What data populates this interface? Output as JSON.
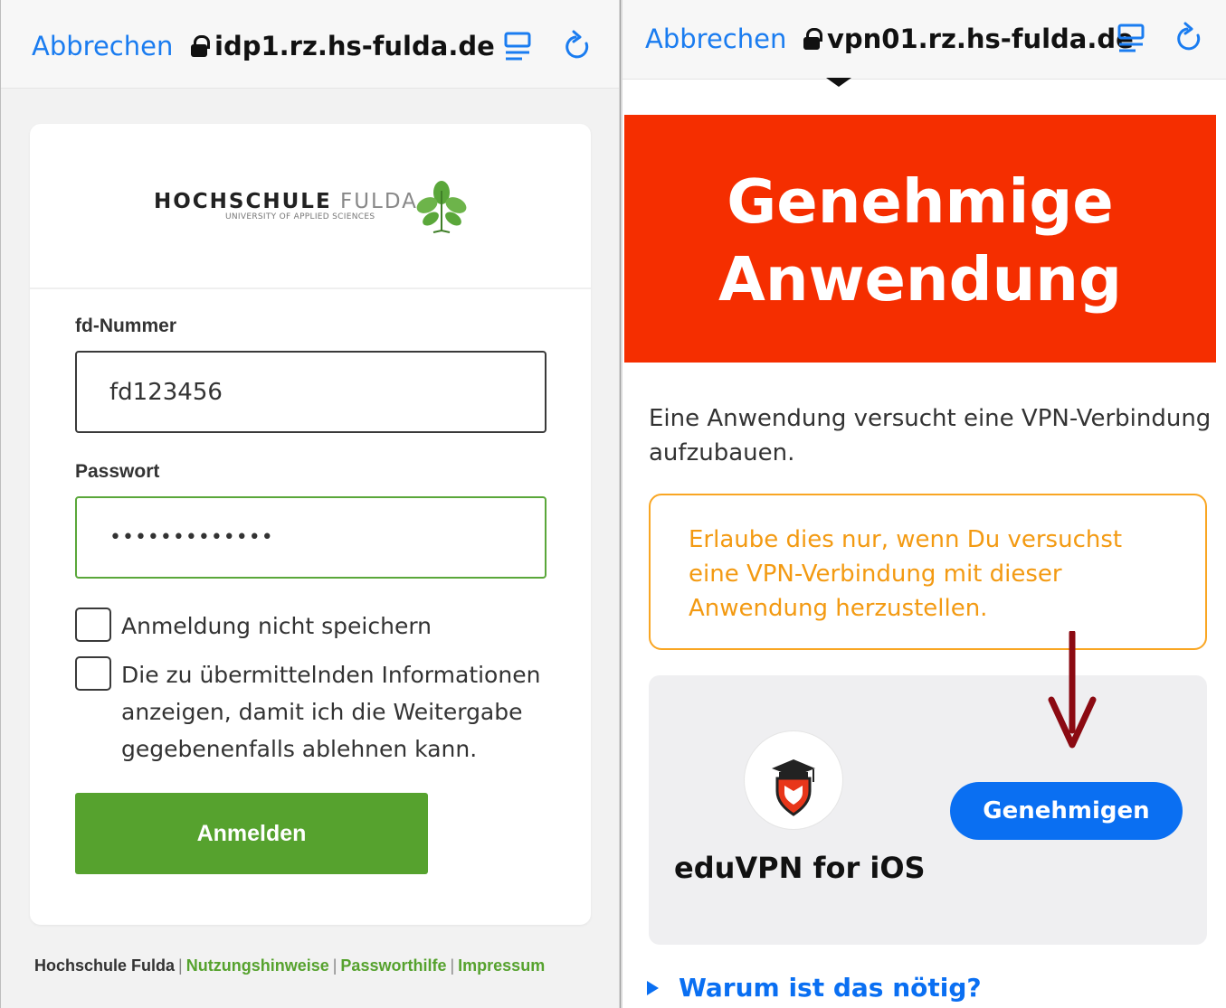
{
  "left_panel": {
    "topbar": {
      "cancel_label": "Abbrechen",
      "url": "idp1.rz.hs-fulda.de"
    },
    "logo": {
      "name_bold": "HOCHSCHULE",
      "name_light": "FULDA",
      "subtitle": "UNIVERSITY OF APPLIED SCIENCES"
    },
    "form": {
      "username_label": "fd-Nummer",
      "username_value": "fd123456",
      "password_label": "Passwort",
      "password_value": "•••••••••••••",
      "checkbox1_label": "Anmeldung nicht speichern",
      "checkbox2_lines": [
        "Die zu übermittelnden Informationen",
        "anzeigen, damit ich die Weitergabe",
        "gegebenenfalls ablehnen kann."
      ],
      "checkbox1_checked": false,
      "checkbox2_checked": false,
      "submit_label": "Anmelden"
    },
    "footer": {
      "org": "Hochschule Fulda",
      "sep": "|",
      "link1": "Nutzungshinweise",
      "link2": "Passworthilfe",
      "link3": "Impressum"
    }
  },
  "right_panel": {
    "topbar": {
      "cancel_label": "Abbrechen",
      "url": "vpn01.rz.hs-fulda.de"
    },
    "hero": {
      "line1": "Genehmige",
      "line2": "Anwendung"
    },
    "intro_lines": [
      "Eine Anwendung versucht eine VPN-Verbindung",
      "aufzubauen."
    ],
    "warning_lines": [
      "Erlaube dies nur, wenn Du versuchst",
      "eine VPN-Verbindung mit dieser",
      "Anwendung herzustellen."
    ],
    "app": {
      "name": "eduVPN for iOS",
      "approve_label": "Genehmigen"
    },
    "why_label": "Warum ist das nötig?"
  },
  "colors": {
    "ios_blue": "#1a7cf0",
    "hs_green": "#56a22e",
    "hero_red": "#f52e00",
    "warning_orange": "#f39a12",
    "approve_blue": "#0a6ff2",
    "annotation_arrow": "#8b0a12"
  },
  "icons": [
    "lock-icon",
    "reader-mode-icon",
    "reload-icon",
    "leaf-logo-icon",
    "eduvpn-icon",
    "annotation-arrow-icon",
    "disclosure-triangle-icon"
  ]
}
